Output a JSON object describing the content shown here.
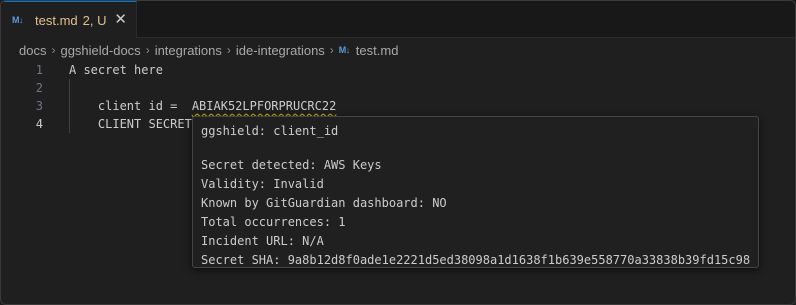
{
  "tab": {
    "icon": "M↓",
    "filename": "test.md",
    "status": "2, U",
    "close": "✕"
  },
  "breadcrumb": {
    "items": [
      "docs",
      "ggshield-docs",
      "integrations",
      "ide-integrations"
    ],
    "file_icon": "M↓",
    "file": "test.md",
    "separator": "›"
  },
  "code": {
    "lines": [
      {
        "number": "1",
        "text": "A secret here"
      },
      {
        "number": "2",
        "text": ""
      },
      {
        "number": "3",
        "prefix": "    client id =  ",
        "secret": "ABIAK52LPFORPRUCRC22"
      },
      {
        "number": "4",
        "text": "    CLIENT SECRET"
      }
    ]
  },
  "hover": {
    "title": "ggshield: client_id",
    "details": [
      "Secret detected: AWS Keys",
      "Validity: Invalid",
      "Known by GitGuardian dashboard: NO",
      "Total occurrences: 1",
      "Incident URL: N/A",
      "Secret SHA: 9a8b12d8f0ade1e2221d5ed38098a1d1638f1b639e558770a33838b39fd15c98"
    ]
  },
  "colors": {
    "accent": "#0078d4",
    "modified_file": "#e2c08d",
    "warning_squiggle": "#cca700",
    "markdown_icon": "#5a9bd8"
  }
}
